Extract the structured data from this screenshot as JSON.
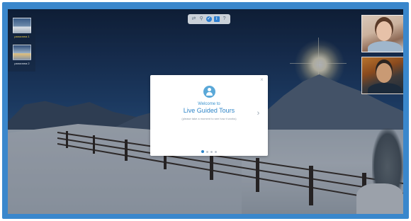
{
  "toolbar": {
    "icons": [
      "share-icon",
      "pin-icon",
      "check-icon",
      "info-icon",
      "help-icon"
    ]
  },
  "panoramas": [
    {
      "label": "panorama 1",
      "active": true
    },
    {
      "label": "panorama 2",
      "active": false
    }
  ],
  "participants": [
    {
      "label": "participant-1"
    },
    {
      "label": "participant-2"
    }
  ],
  "dialog": {
    "welcome": "Welcome to",
    "title": "Live Guided Tours",
    "subtitle": "(please take a moment to see how it works)",
    "close_glyph": "×",
    "next_glyph": "›",
    "page_count": 4,
    "current_page": 1
  },
  "colors": {
    "frame": "#3a87cc",
    "accent": "#2f85c8",
    "active_pano": "#f2d24a"
  }
}
